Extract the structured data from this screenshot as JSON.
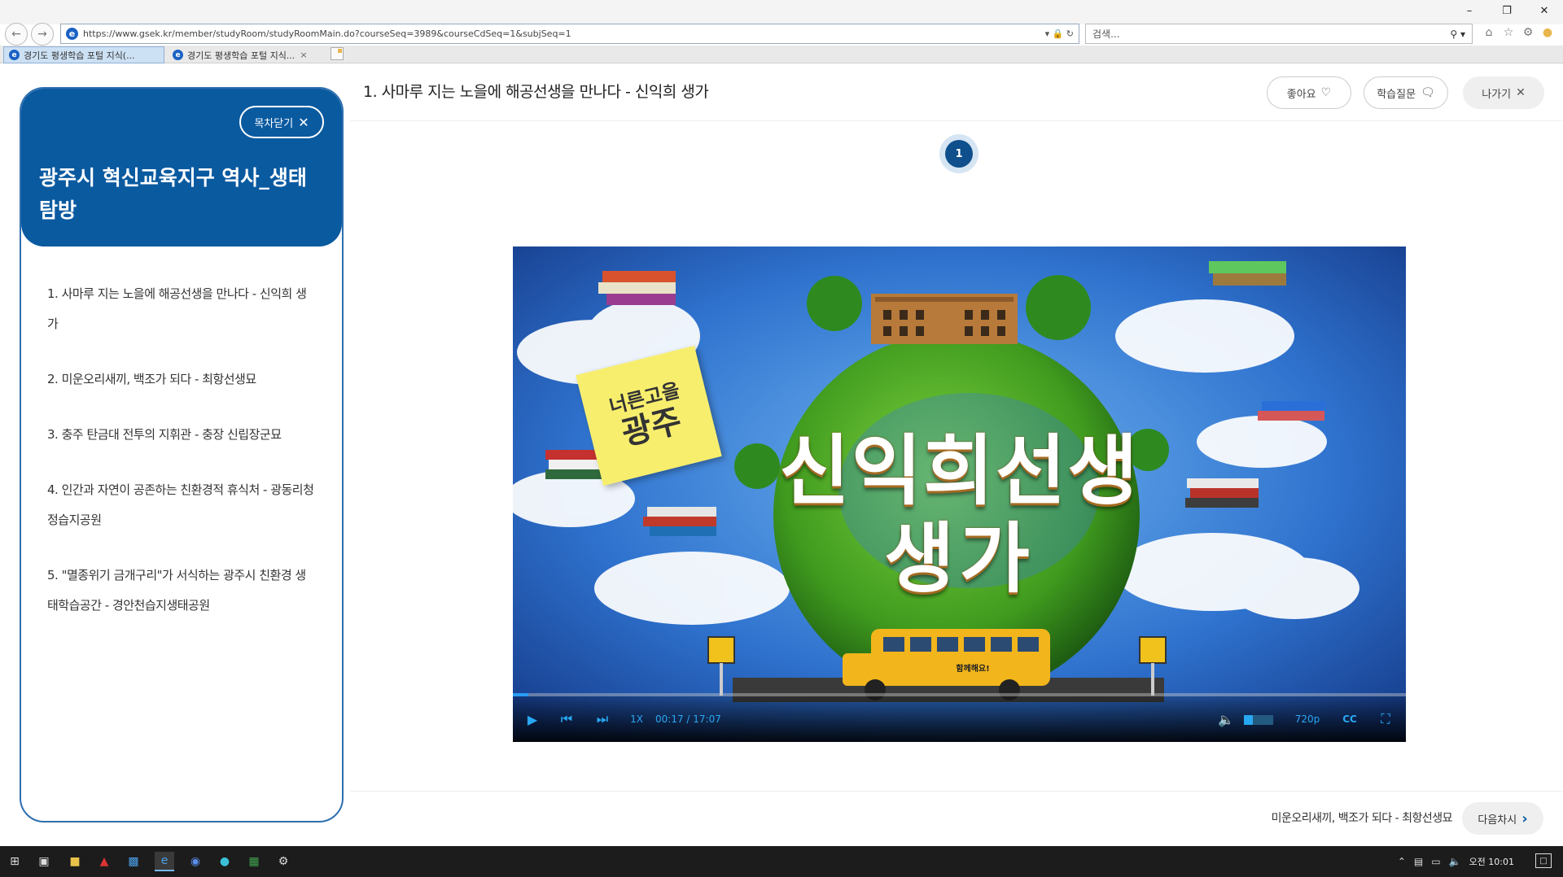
{
  "browser": {
    "url": "https://www.gsek.kr/member/studyRoom/studyRoomMain.do?courseSeq=3989&courseCdSeq=1&subjSeq=1",
    "search_placeholder": "검색...",
    "tabs": [
      {
        "label": "경기도 평생학습 포털 지식(...",
        "active": true
      },
      {
        "label": "경기도 평생학습 포털 지식...",
        "active": false
      }
    ]
  },
  "sidebar": {
    "close_label": "목차닫기",
    "course_title": "광주시 혁신교육지구 역사_생태 탐방",
    "lessons": [
      "1. 사마루 지는 노을에 해공선생을 만나다 - 신익희 생가",
      "2. 미운오리새끼, 백조가 되다 - 최항선생묘",
      "3. 충주 탄금대 전투의 지휘관 - 충장 신립장군묘",
      "4. 인간과 자연이 공존하는 친환경적 휴식처 - 광동리청정습지공원",
      "5. \"멸종위기 금개구리\"가 서식하는 광주시 친환경 생태학습공간 - 경안천습지생태공원"
    ]
  },
  "header": {
    "lesson_title": "1. 사마루 지는 노을에 해공선생을 만나다 - 신익희 생가",
    "like_label": "좋아요",
    "question_label": "학습질문",
    "exit_label": "나가기"
  },
  "step": {
    "current": "1"
  },
  "video": {
    "sticky_line1": "너른고을",
    "sticky_line2": "광주",
    "title_line1": "신익희선생",
    "title_line2": "생가",
    "bus_text": "함께해요!",
    "speed": "1X",
    "time": "00:17 / 17:07",
    "quality": "720p",
    "progress_fraction": 0.017,
    "volume_fraction": 0.3
  },
  "footer": {
    "next_lesson_label": "미운오리새끼, 백조가 되다 - 최항선생묘",
    "next_button_label": "다음차시"
  },
  "taskbar": {
    "clock": "오전 10:01"
  },
  "colors": {
    "primary": "#0a5aa0",
    "player_accent": "#28a7f2"
  }
}
